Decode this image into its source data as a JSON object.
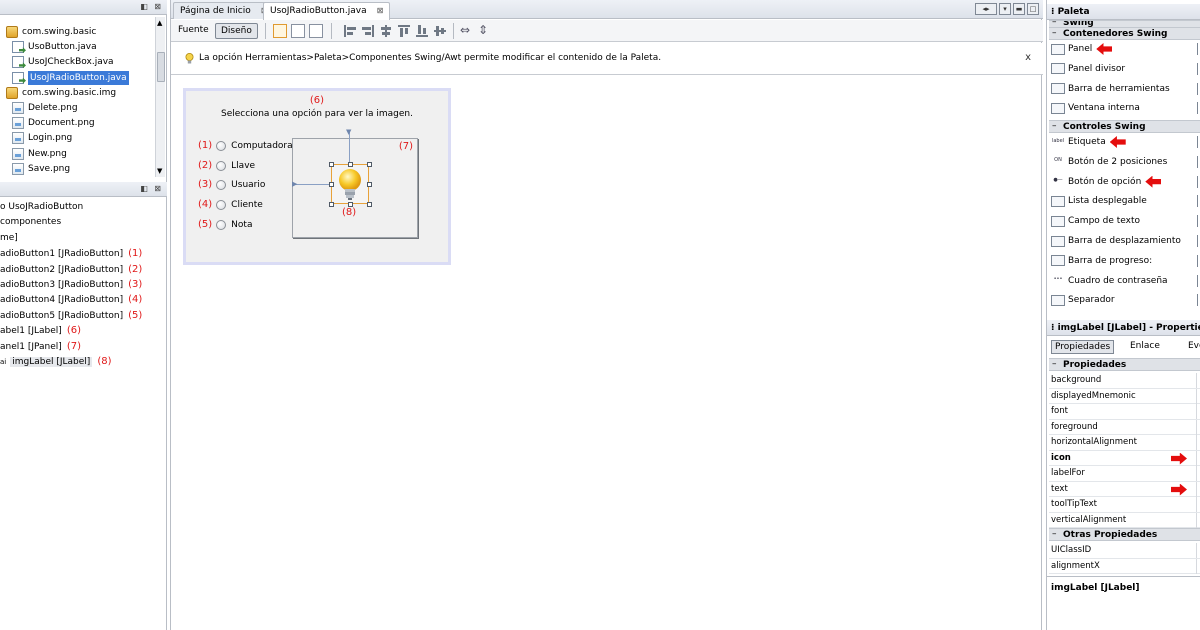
{
  "left": {
    "project_tree": [
      {
        "label": "com.swing.basic",
        "icon": "package-icon",
        "indent": 1
      },
      {
        "label": "UsoButton.java",
        "icon": "java-file-icon",
        "indent": 2
      },
      {
        "label": "UsoJCheckBox.java",
        "icon": "java-file-icon",
        "indent": 2
      },
      {
        "label": "UsoJRadioButton.java",
        "icon": "java-file-icon",
        "indent": 2,
        "selected": true
      },
      {
        "label": "com.swing.basic.img",
        "icon": "package-icon",
        "indent": 1
      },
      {
        "label": "Delete.png",
        "icon": "image-file-icon",
        "indent": 2
      },
      {
        "label": "Document.png",
        "icon": "image-file-icon",
        "indent": 2
      },
      {
        "label": "Login.png",
        "icon": "image-file-icon",
        "indent": 2
      },
      {
        "label": "New.png",
        "icon": "image-file-icon",
        "indent": 2
      },
      {
        "label": "Save.png",
        "icon": "image-file-icon",
        "indent": 2
      }
    ],
    "navigator": [
      {
        "label": "o UsoJRadioButton",
        "num": ""
      },
      {
        "label": "componentes",
        "num": ""
      },
      {
        "label": "me]",
        "num": ""
      },
      {
        "label": "adioButton1 [JRadioButton]",
        "num": "(1)"
      },
      {
        "label": "adioButton2 [JRadioButton]",
        "num": "(2)"
      },
      {
        "label": "adioButton3 [JRadioButton]",
        "num": "(3)"
      },
      {
        "label": "adioButton4 [JRadioButton]",
        "num": "(4)"
      },
      {
        "label": "adioButton5 [JRadioButton]",
        "num": "(5)"
      },
      {
        "label": "abel1 [JLabel]",
        "num": "(6)"
      },
      {
        "label": "anel1 [JPanel]",
        "num": "(7)"
      },
      {
        "label": "imgLabel [JLabel]",
        "num": "(8)",
        "prefix": "ai",
        "highlighted": true
      }
    ]
  },
  "editor": {
    "tabs": [
      {
        "label": "Página de Inicio",
        "close": "⊠",
        "active": false
      },
      {
        "label": "UsoJRadioButton.java",
        "close": "⊠",
        "active": true
      }
    ],
    "toolbar": {
      "source_label": "Fuente",
      "design_label": "Diseño"
    },
    "hint": {
      "text": "La opción Herramientas>Paleta>Componentes Swing/Awt permite modificar el contenido de la Paleta.",
      "close": "x"
    },
    "form": {
      "label_num": "(6)",
      "label_text": "Selecciona una opción para ver la imagen.",
      "panel_num": "(7)",
      "img_num": "(8)",
      "radios": [
        {
          "num": "(1)",
          "label": "Computadora"
        },
        {
          "num": "(2)",
          "label": "Llave"
        },
        {
          "num": "(3)",
          "label": "Usuario"
        },
        {
          "num": "(4)",
          "label": "Cliente"
        },
        {
          "num": "(5)",
          "label": "Nota"
        }
      ]
    }
  },
  "palette": {
    "title": "Paleta",
    "cut_header": "Swing",
    "categories": [
      {
        "label": "Contenedores Swing"
      },
      {
        "label": "Controles Swing"
      }
    ],
    "containers": [
      {
        "label": "Panel",
        "arrow": true
      },
      {
        "label": "Panel divisor",
        "arrow": false
      },
      {
        "label": "Barra de herramientas",
        "arrow": false
      },
      {
        "label": "Ventana interna",
        "arrow": false
      }
    ],
    "controls": [
      {
        "label": "Etiqueta",
        "icon_text": "label",
        "arrow": true
      },
      {
        "label": "Botón de 2 posiciones",
        "icon_text": "ON",
        "arrow": false
      },
      {
        "label": "Botón de opción",
        "icon_text": "●—",
        "arrow": true
      },
      {
        "label": "Lista desplegable",
        "icon_text": "",
        "arrow": false
      },
      {
        "label": "Campo de texto",
        "icon_text": "",
        "arrow": false
      },
      {
        "label": "Barra de desplazamiento",
        "icon_text": "",
        "arrow": false
      },
      {
        "label": "Barra de progreso:",
        "icon_text": "",
        "arrow": false
      },
      {
        "label": "Cuadro de contraseña",
        "icon_text": "•••",
        "arrow": false
      },
      {
        "label": "Separador",
        "icon_text": "",
        "arrow": false
      }
    ]
  },
  "properties": {
    "title": "imgLabel [JLabel] - Properties",
    "tabs": [
      "Propiedades",
      "Enlace",
      "Eve"
    ],
    "category1": "Propiedades",
    "rows": [
      {
        "name": "background",
        "bold": false,
        "arrow": false
      },
      {
        "name": "displayedMnemonic",
        "bold": false,
        "arrow": false
      },
      {
        "name": "font",
        "bold": false,
        "arrow": false
      },
      {
        "name": "foreground",
        "bold": false,
        "arrow": false
      },
      {
        "name": "horizontalAlignment",
        "bold": false,
        "arrow": false
      },
      {
        "name": "icon",
        "bold": true,
        "arrow": true
      },
      {
        "name": "labelFor",
        "bold": false,
        "arrow": false
      },
      {
        "name": "text",
        "bold": false,
        "arrow": true
      },
      {
        "name": "toolTipText",
        "bold": false,
        "arrow": false
      },
      {
        "name": "verticalAlignment",
        "bold": false,
        "arrow": false
      }
    ],
    "category2": "Otras Propiedades",
    "rows2": [
      {
        "name": "UIClassID"
      },
      {
        "name": "alignmentX"
      }
    ],
    "footer": "imgLabel [JLabel]"
  },
  "colors": {
    "annotation_red": "#e01818",
    "arrow_red": "#e40d0d",
    "selection_blue": "#3b7ad8",
    "form_border": "#dadcf5",
    "img_label_border": "#e8a23a"
  }
}
